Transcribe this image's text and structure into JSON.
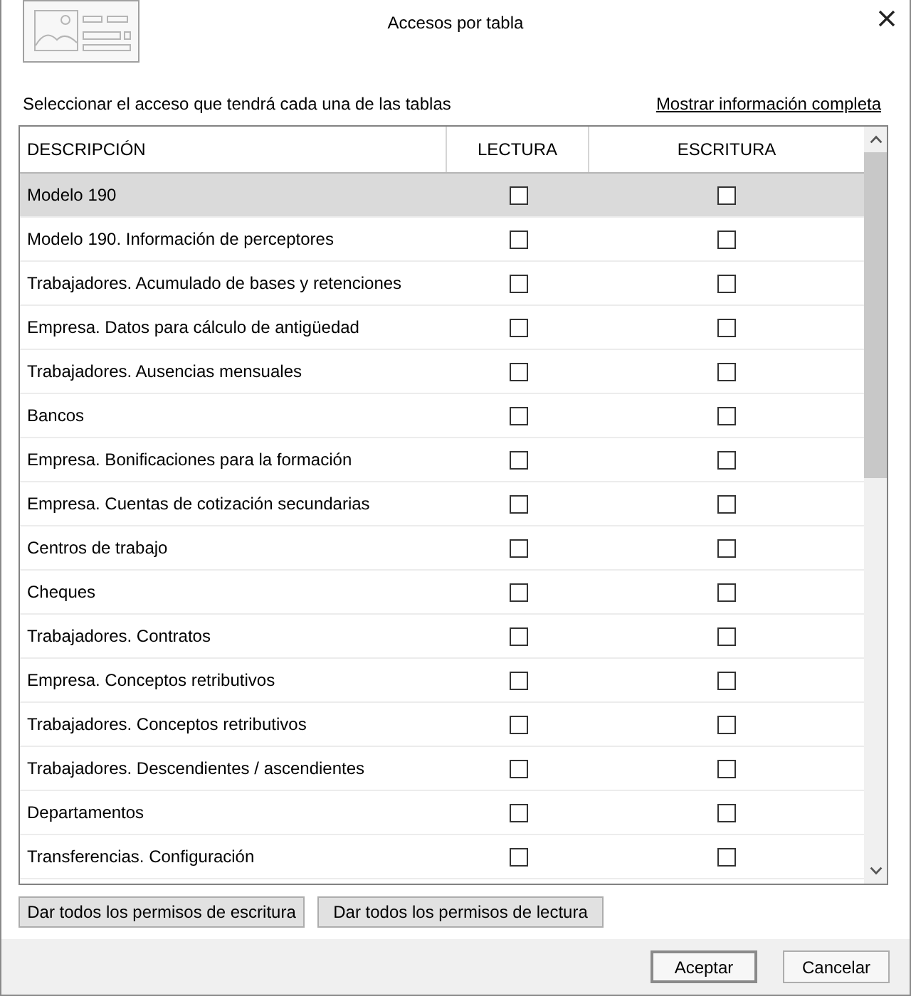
{
  "window": {
    "title": "Accesos por tabla"
  },
  "instructions": "Seleccionar el acceso que tendrá cada una de las tablas",
  "details_link": "Mostrar información completa",
  "table": {
    "columns": [
      "DESCRIPCIÓN",
      "LECTURA",
      "ESCRITURA"
    ],
    "rows": [
      {
        "description": "Modelo 190",
        "read": false,
        "write": false,
        "selected": true
      },
      {
        "description": "Modelo 190. Información de perceptores",
        "read": false,
        "write": false,
        "selected": false
      },
      {
        "description": "Trabajadores. Acumulado de bases y retenciones",
        "read": false,
        "write": false,
        "selected": false
      },
      {
        "description": "Empresa. Datos para cálculo de antigüedad",
        "read": false,
        "write": false,
        "selected": false
      },
      {
        "description": "Trabajadores. Ausencias mensuales",
        "read": false,
        "write": false,
        "selected": false
      },
      {
        "description": "Bancos",
        "read": false,
        "write": false,
        "selected": false
      },
      {
        "description": "Empresa. Bonificaciones para la formación",
        "read": false,
        "write": false,
        "selected": false
      },
      {
        "description": "Empresa. Cuentas de cotización secundarias",
        "read": false,
        "write": false,
        "selected": false
      },
      {
        "description": "Centros de trabajo",
        "read": false,
        "write": false,
        "selected": false
      },
      {
        "description": "Cheques",
        "read": false,
        "write": false,
        "selected": false
      },
      {
        "description": "Trabajadores. Contratos",
        "read": false,
        "write": false,
        "selected": false
      },
      {
        "description": "Empresa. Conceptos retributivos",
        "read": false,
        "write": false,
        "selected": false
      },
      {
        "description": "Trabajadores. Conceptos retributivos",
        "read": false,
        "write": false,
        "selected": false
      },
      {
        "description": "Trabajadores. Descendientes / ascendientes",
        "read": false,
        "write": false,
        "selected": false
      },
      {
        "description": "Departamentos",
        "read": false,
        "write": false,
        "selected": false
      },
      {
        "description": "Transferencias. Configuración",
        "read": false,
        "write": false,
        "selected": false
      }
    ]
  },
  "bulk_buttons": [
    "Dar todos los permisos de escritura",
    "Dar todos los permisos de lectura"
  ],
  "buttons": [
    {
      "label": "Aceptar",
      "default": true
    },
    {
      "label": "Cancelar",
      "default": false
    }
  ]
}
